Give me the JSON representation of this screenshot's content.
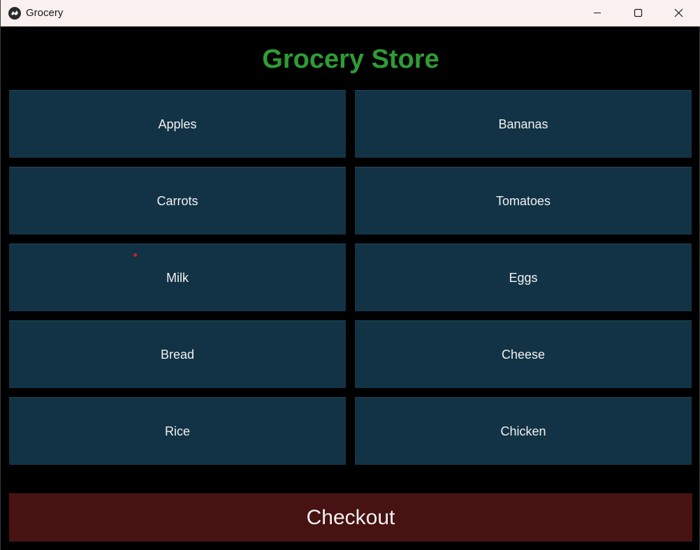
{
  "window": {
    "title": "Grocery",
    "icon": "kivy-app-icon",
    "controls": [
      "minimize-icon",
      "maximize-icon",
      "close-icon"
    ]
  },
  "heading": "Grocery Store",
  "items": [
    {
      "label": "Apples"
    },
    {
      "label": "Bananas"
    },
    {
      "label": "Carrots"
    },
    {
      "label": "Tomatoes"
    },
    {
      "label": "Milk"
    },
    {
      "label": "Eggs"
    },
    {
      "label": "Bread"
    },
    {
      "label": "Cheese"
    },
    {
      "label": "Rice"
    },
    {
      "label": "Chicken"
    }
  ],
  "checkout_label": "Checkout",
  "colors": {
    "heading": "#2e9c35",
    "item_button": "#123345",
    "checkout_button": "#471212",
    "background": "#000000",
    "titlebar": "#f8f1ef",
    "cursor_dot": "#d01f1f"
  }
}
